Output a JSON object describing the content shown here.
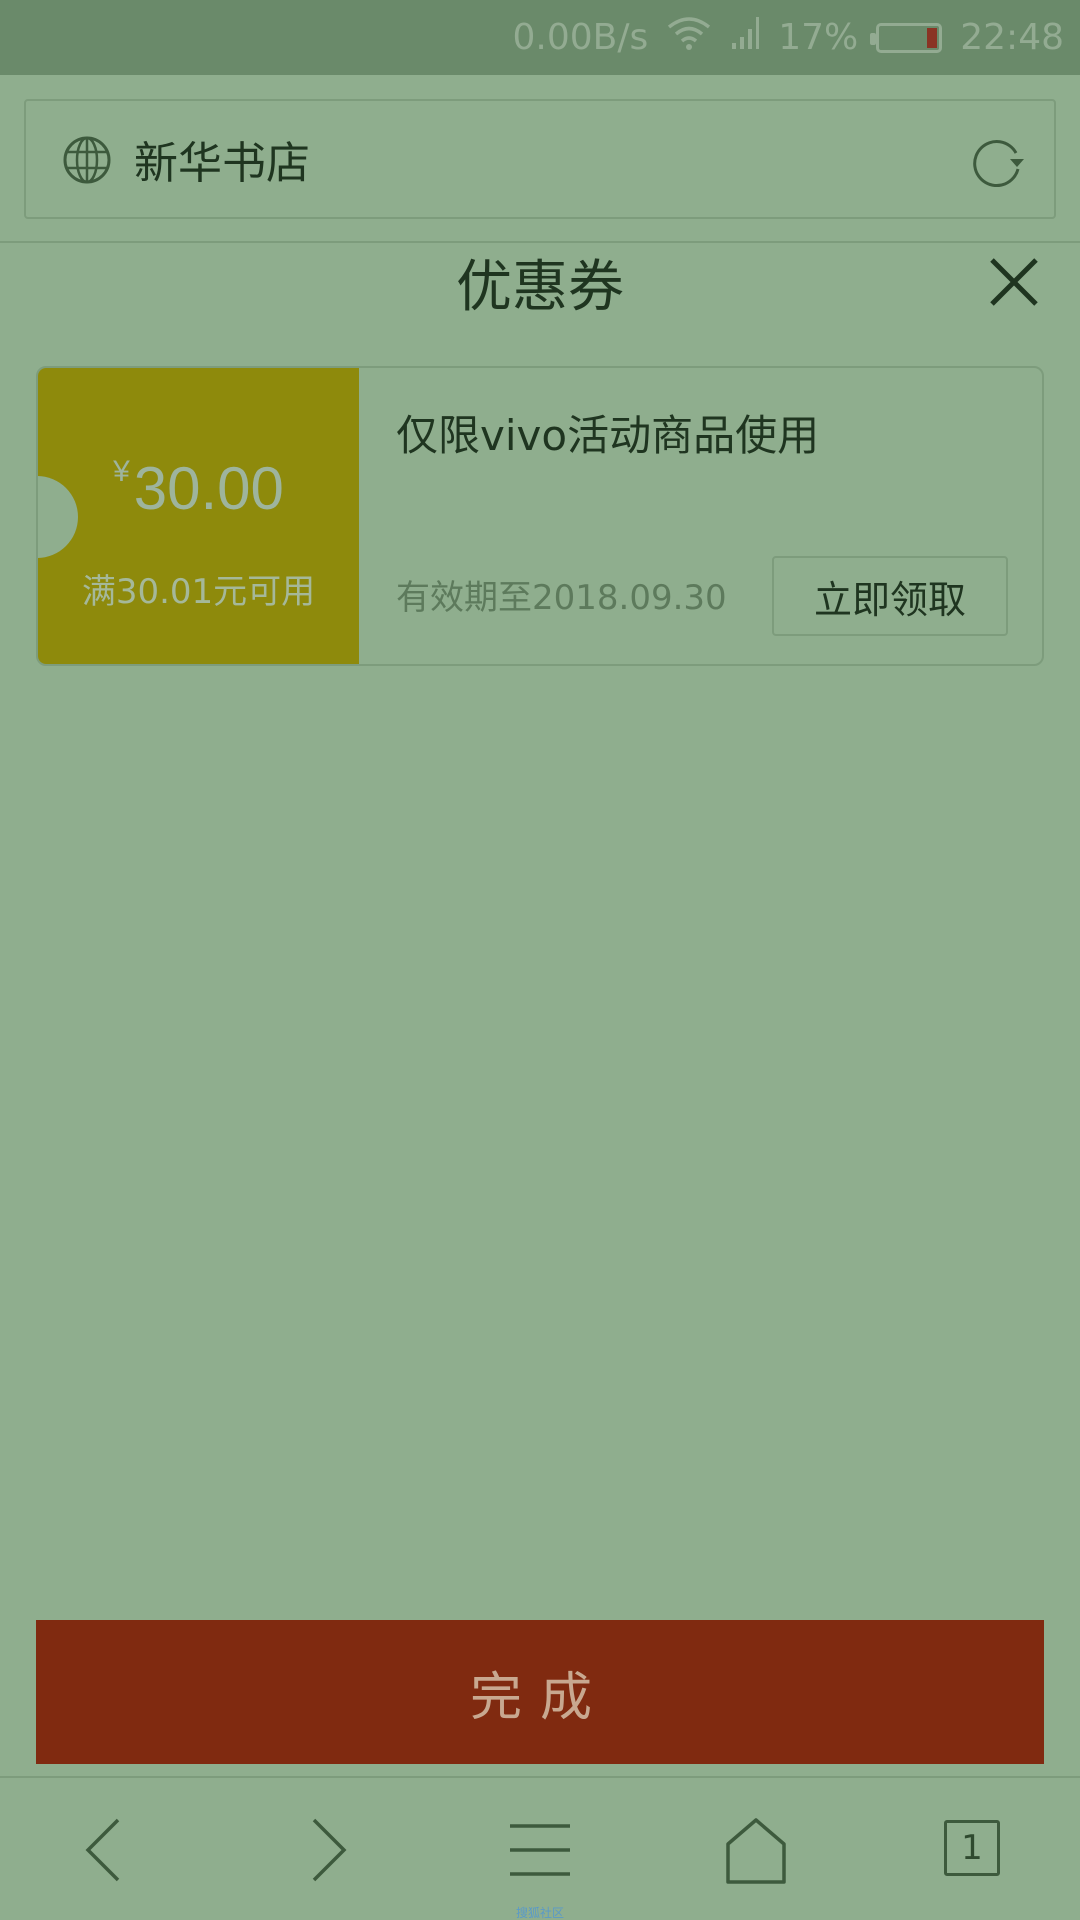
{
  "status_bar": {
    "net_speed": "0.00B/s",
    "battery_percent": "17%",
    "battery_level": 0.17,
    "time": "22:48",
    "icons": [
      "wifi-icon",
      "signal-icon",
      "battery-icon"
    ]
  },
  "address_bar": {
    "title": "新华书店",
    "icons": [
      "globe-icon",
      "reload-icon"
    ]
  },
  "panel": {
    "title": "优惠券",
    "close_icon": "close-icon"
  },
  "coupon": {
    "currency": "¥",
    "amount": "30.00",
    "condition": "满30.01元可用",
    "description": "仅限vivo活动商品使用",
    "validity": "有效期至2018.09.30",
    "claim_label": "立即领取"
  },
  "done_label": "完成",
  "bottom_nav": {
    "items": [
      "back-icon",
      "forward-icon",
      "menu-icon",
      "home-icon",
      "tabs-icon"
    ],
    "tab_count": "1"
  },
  "watermark": "搜狐社区",
  "colors": {
    "overlay_bg": "#8fae8e",
    "coupon_left": "#8e8a0c",
    "done_button": "#802a10"
  }
}
